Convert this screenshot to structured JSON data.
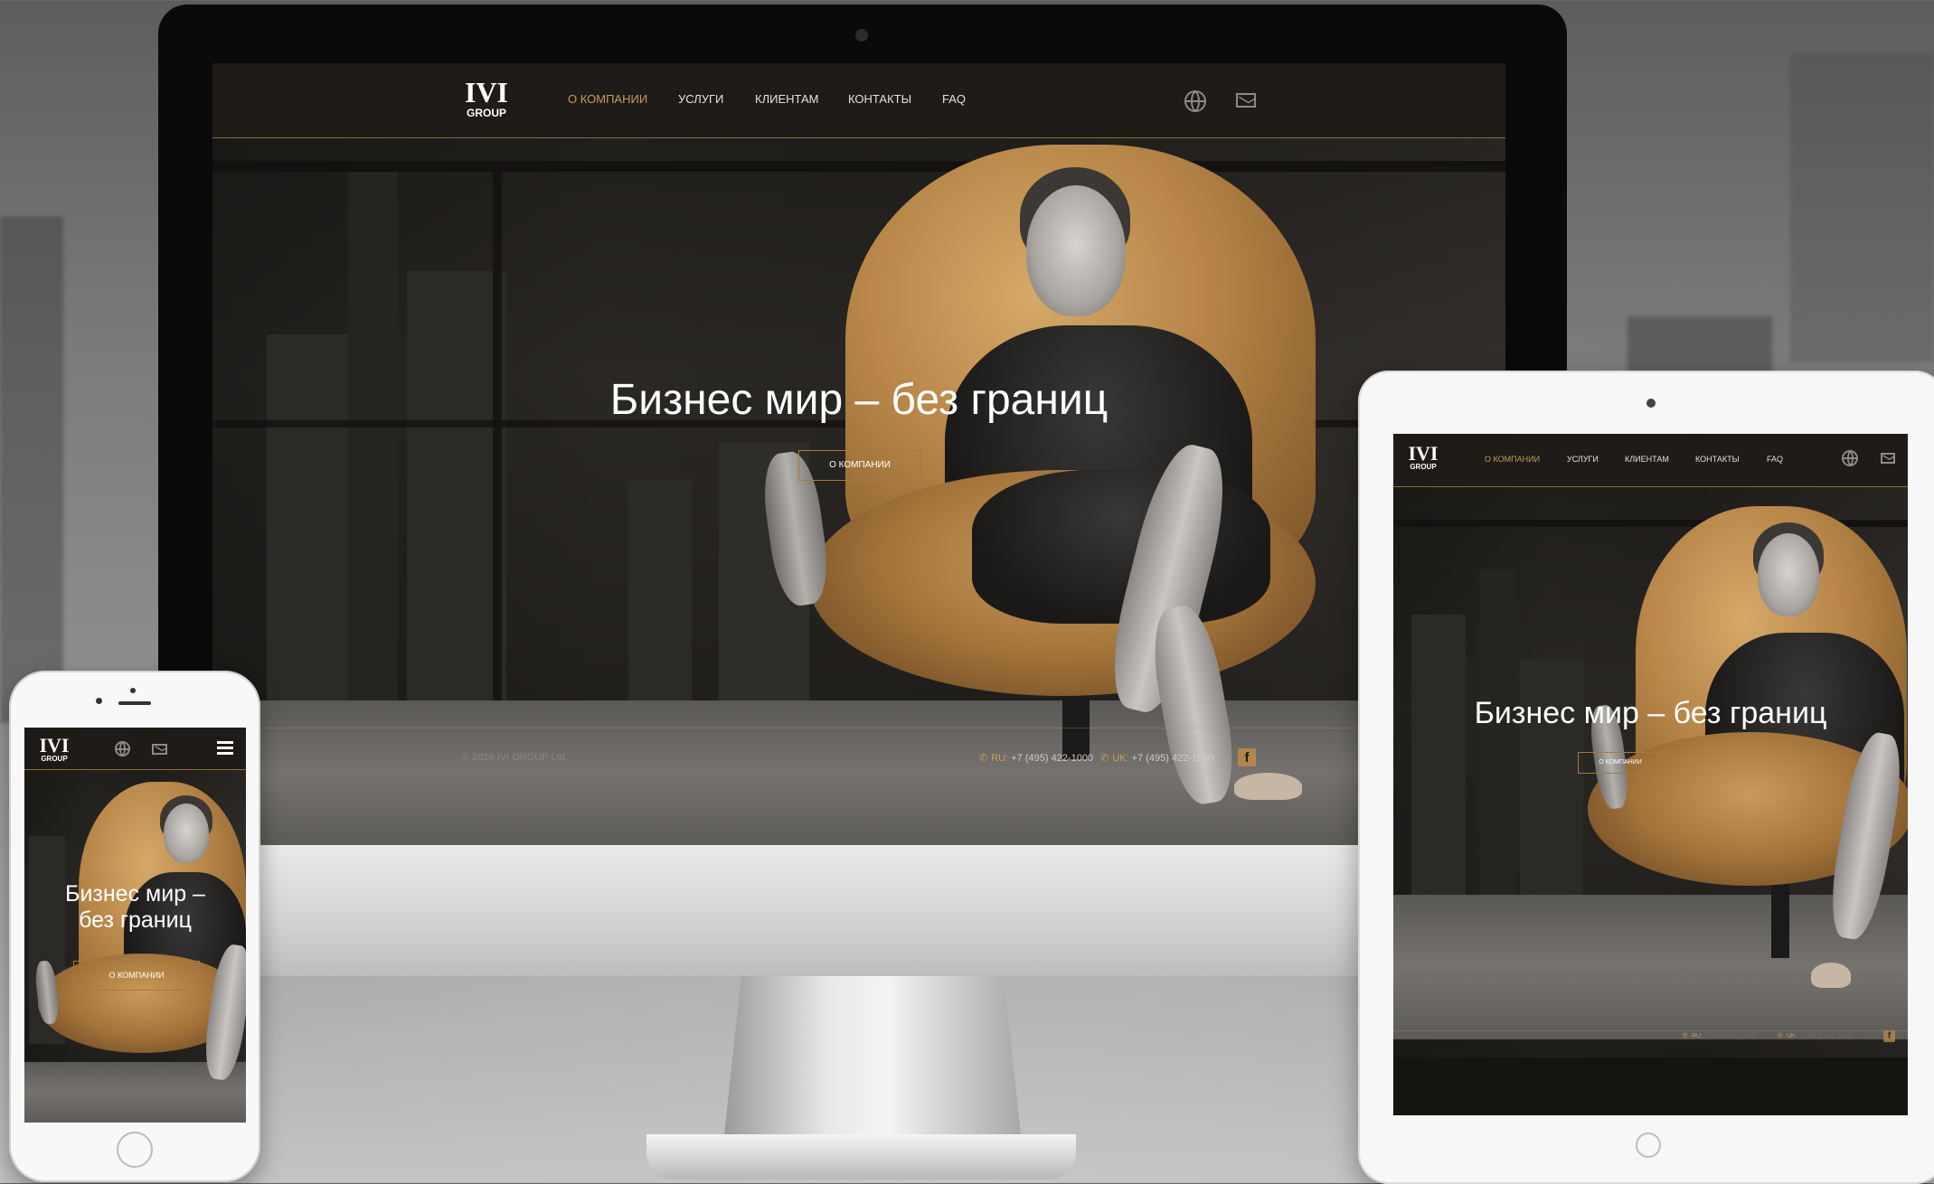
{
  "brand": {
    "logo_main": "IVI",
    "logo_sub": "GROUP"
  },
  "nav": {
    "items": [
      {
        "label": "О КОМПАНИИ",
        "active": true
      },
      {
        "label": "УСЛУГИ",
        "active": false
      },
      {
        "label": "КЛИЕНТАМ",
        "active": false
      },
      {
        "label": "КОНТАКТЫ",
        "active": false
      },
      {
        "label": "FAQ",
        "active": false
      }
    ],
    "icons": [
      "globe-icon",
      "mail-icon"
    ]
  },
  "hero": {
    "headline": "Бизнес мир – без границ",
    "headline_mobile_line1": "Бизнес мир –",
    "headline_mobile_line2": "без границ",
    "cta_label": "О КОМПАНИИ"
  },
  "footer": {
    "copyright": "© 2016 IVI GROUP Ltd.",
    "phone_ru_label": "RU:",
    "phone_ru": "+7 (495) 422-1000",
    "phone_uk_label": "UK:",
    "phone_uk": "+7 (495) 422-1000",
    "social": "f"
  },
  "colors": {
    "accent": "#c89a58",
    "dark": "#1d1b18",
    "text": "#ffffff"
  }
}
